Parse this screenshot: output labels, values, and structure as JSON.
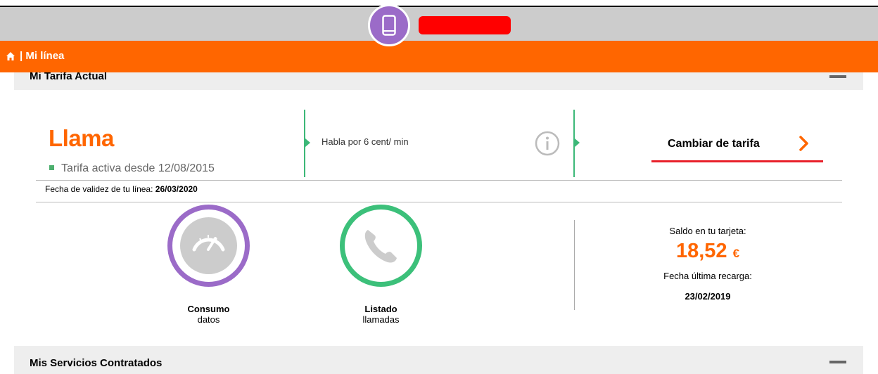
{
  "header": {
    "breadcrumb_separator": "|",
    "breadcrumb": "Mi línea",
    "phone_icon": "smartphone-icon",
    "home_icon": "home-icon"
  },
  "sections": {
    "current_plan_title": "Mi Tarifa Actual",
    "services_title": "Mis Servicios Contratados"
  },
  "plan": {
    "name": "Llama",
    "active_since": "Tarifa activa desde 12/08/2015",
    "description": "Habla por 6 cent/ min",
    "change_label": "Cambiar de tarifa",
    "validity_label": "Fecha de validez de tu línea:",
    "validity_date": "26/03/2020"
  },
  "usage": {
    "data_title": "Consumo",
    "data_sub": "datos",
    "calls_title": "Listado",
    "calls_sub": "llamadas"
  },
  "balance": {
    "label": "Saldo en tu tarjeta:",
    "amount": "18,52",
    "currency": "€",
    "recharge_label": "Fecha última recarga:",
    "recharge_date": "23/02/2019"
  },
  "colors": {
    "brand_orange": "#ff6600",
    "accent_green": "#3cb878",
    "accent_purple": "#9b6bc8",
    "underline_red": "#e8202a"
  }
}
